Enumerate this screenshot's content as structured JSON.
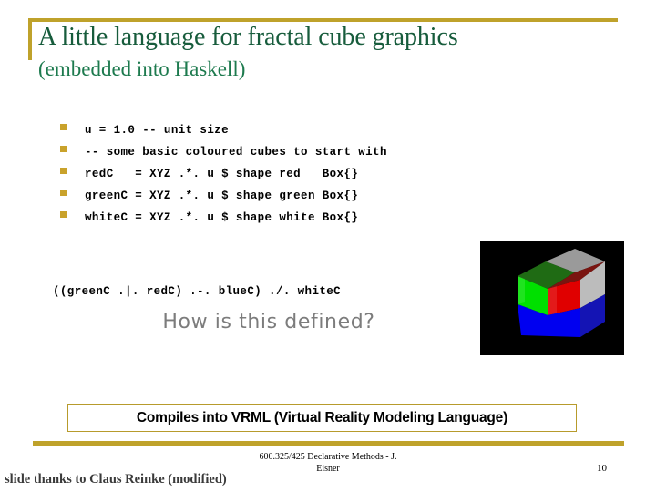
{
  "slide": {
    "title_line1": "A little language for fractal cube graphics",
    "title_line2": "(embedded into Haskell)",
    "title_color": "#175c3c",
    "accent_color": "#bfa22b"
  },
  "code_block": {
    "bullet_color": "#c9a22b",
    "lines": [
      "u = 1.0 -- unit size",
      "-- some basic coloured cubes to start with",
      "redC   = XYZ .*. u $ shape red   Box{}",
      "greenC = XYZ .*. u $ shape green Box{}",
      "whiteC = XYZ .*. u $ shape white Box{}"
    ]
  },
  "expression": {
    "text": "((greenC .|. redC) .-. blueC) ./. whiteC"
  },
  "question": {
    "text": "How is this defined?",
    "color": "#7c7c7c"
  },
  "cube_render": {
    "background": "#000000",
    "faces": {
      "front_top_left": "#00e000",
      "front_top_right": "#e00000",
      "front_bottom": "#0000f0",
      "right_side": "#b4b4b4",
      "top_left": "#1f6b14",
      "top_right": "#7a1410",
      "right_bottom": "#1414b4"
    }
  },
  "vrml_caption": {
    "text": "Compiles into VRML (Virtual Reality Modeling Language)",
    "border_color": "#b79b2c"
  },
  "footer": {
    "course_line1": "600.325/425 Declarative Methods - J.",
    "course_line2": "Eisner",
    "page_number": "10",
    "credit": "slide thanks to Claus Reinke (modified)"
  }
}
